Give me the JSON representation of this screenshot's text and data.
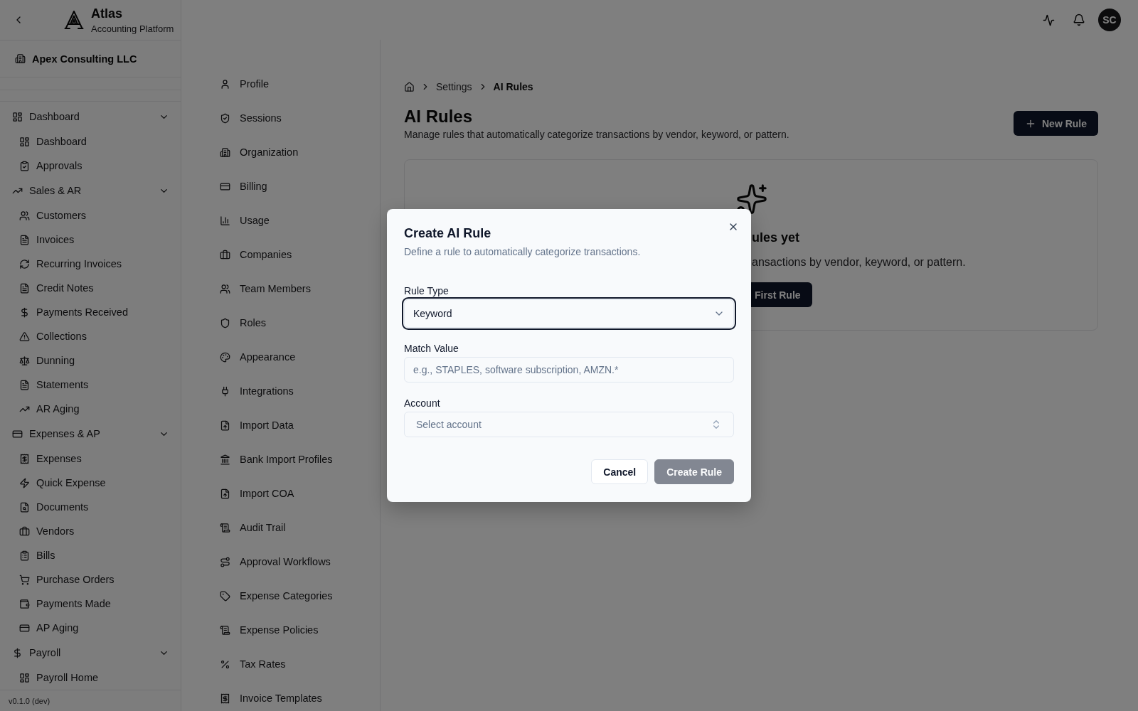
{
  "app": {
    "name": "Atlas",
    "tagline": "Accounting Platform"
  },
  "organization": {
    "name": "Apex Consulting LLC"
  },
  "sidebar": {
    "groups": [
      {
        "label": "Dashboard",
        "expanded": true,
        "children": [
          {
            "label": "Dashboard"
          },
          {
            "label": "Approvals"
          }
        ]
      },
      {
        "label": "Sales & AR",
        "expanded": true,
        "children": [
          {
            "label": "Customers"
          },
          {
            "label": "Invoices"
          },
          {
            "label": "Recurring Invoices"
          },
          {
            "label": "Credit Notes"
          },
          {
            "label": "Payments Received"
          },
          {
            "label": "Collections"
          },
          {
            "label": "Dunning"
          },
          {
            "label": "Statements"
          },
          {
            "label": "AR Aging"
          }
        ]
      },
      {
        "label": "Expenses & AP",
        "expanded": true,
        "children": [
          {
            "label": "Expenses"
          },
          {
            "label": "Quick Expense"
          },
          {
            "label": "Documents"
          },
          {
            "label": "Vendors"
          },
          {
            "label": "Bills"
          },
          {
            "label": "Purchase Orders"
          },
          {
            "label": "Payments Made"
          },
          {
            "label": "AP Aging"
          }
        ]
      },
      {
        "label": "Payroll",
        "expanded": true,
        "children": [
          {
            "label": "Payroll Home"
          }
        ]
      }
    ],
    "version": "v0.1.0 (dev)"
  },
  "user": {
    "initials": "SC"
  },
  "settings_nav": [
    "Profile",
    "Sessions",
    "Organization",
    "Billing",
    "Usage",
    "Companies",
    "Team Members",
    "Roles",
    "Appearance",
    "Integrations",
    "Import Data",
    "Bank Import Profiles",
    "Import COA",
    "Audit Trail",
    "Approval Workflows",
    "Expense Categories",
    "Expense Policies",
    "Tax Rates",
    "Invoice Templates"
  ],
  "breadcrumb": [
    {
      "label": "Settings",
      "current": false
    },
    {
      "label": "AI Rules",
      "current": true
    }
  ],
  "page": {
    "title": "AI Rules",
    "subtitle": "Manage rules that automatically categorize transactions by vendor, keyword, or pattern.",
    "action": "New Rule"
  },
  "empty_state": {
    "title": "ules yet",
    "description": "ansactions by vendor, keyword, or pattern.",
    "action": "First Rule"
  },
  "dialog": {
    "title": "Create AI Rule",
    "description": "Define a rule to automatically categorize transactions.",
    "fields": [
      {
        "kind": "select",
        "label": "Rule Type",
        "value": "Keyword",
        "focused": true
      },
      {
        "kind": "input",
        "label": "Match Value",
        "placeholder": "e.g., STAPLES, software subscription, AMZN.*",
        "focused": false
      },
      {
        "kind": "combobox",
        "label": "Account",
        "placeholder": "Select account",
        "focused": false
      }
    ],
    "buttons": [
      {
        "kind": "secondary",
        "label": "Cancel",
        "disabled": false
      },
      {
        "kind": "primary",
        "label": "Create Rule",
        "disabled": true
      }
    ]
  }
}
